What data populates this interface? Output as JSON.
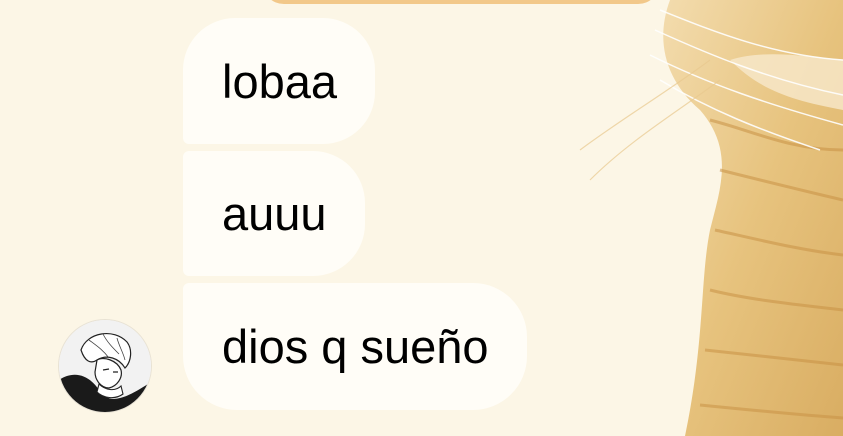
{
  "chat": {
    "messages": [
      {
        "text": "lobaa"
      },
      {
        "text": "auuu"
      },
      {
        "text": "dios q sueño"
      }
    ]
  },
  "colors": {
    "background": "#fcf6e6",
    "bubble": "#fffdf7",
    "outgoing_bubble": "#f2c88a",
    "text": "#000000"
  },
  "icons": {
    "avatar": "manga-character-avatar"
  }
}
